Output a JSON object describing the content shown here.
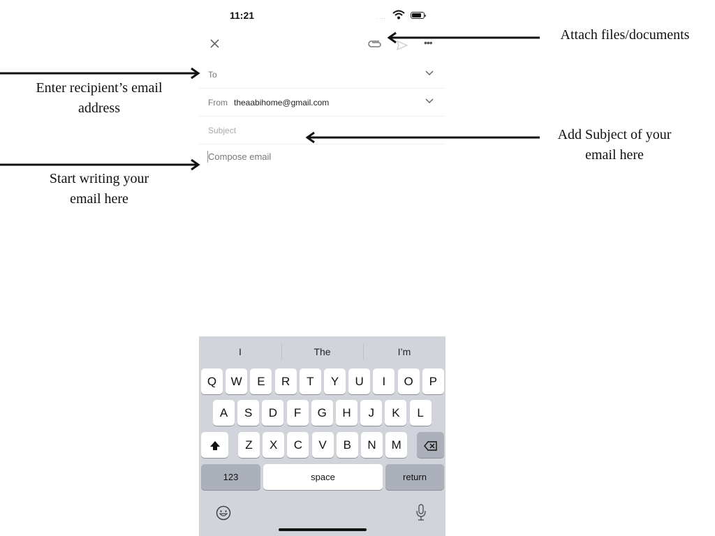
{
  "status_bar": {
    "time": "11:21",
    "signal": "....",
    "icons": [
      "wifi-icon",
      "battery-icon"
    ]
  },
  "toolbar": {
    "icons": [
      "close-icon",
      "attachment-icon",
      "send-icon",
      "more-icon"
    ],
    "more_label": "•••"
  },
  "fields": {
    "to": {
      "label": "To",
      "value": ""
    },
    "from": {
      "label": "From",
      "value": "theaabihome@gmail.com"
    },
    "subject": {
      "placeholder": "Subject"
    },
    "body": {
      "placeholder": "Compose email"
    }
  },
  "annotations": {
    "to": [
      "Enter recipient’s email",
      "address"
    ],
    "compose": [
      "Start writing your",
      "email here"
    ],
    "attach": [
      "Attach files/documents"
    ],
    "subject": [
      "Add Subject of your",
      "email here"
    ]
  },
  "keyboard": {
    "suggestions": [
      "I",
      "The",
      "I’m"
    ],
    "row1": [
      "Q",
      "W",
      "E",
      "R",
      "T",
      "Y",
      "U",
      "I",
      "O",
      "P"
    ],
    "row2": [
      "A",
      "S",
      "D",
      "F",
      "G",
      "H",
      "J",
      "K",
      "L"
    ],
    "row3": [
      "Z",
      "X",
      "C",
      "V",
      "B",
      "N",
      "M"
    ],
    "numbers_label": "123",
    "space_label": "space",
    "return_label": "return",
    "icons": [
      "shift-icon",
      "backspace-icon",
      "emoji-icon",
      "microphone-icon"
    ]
  }
}
